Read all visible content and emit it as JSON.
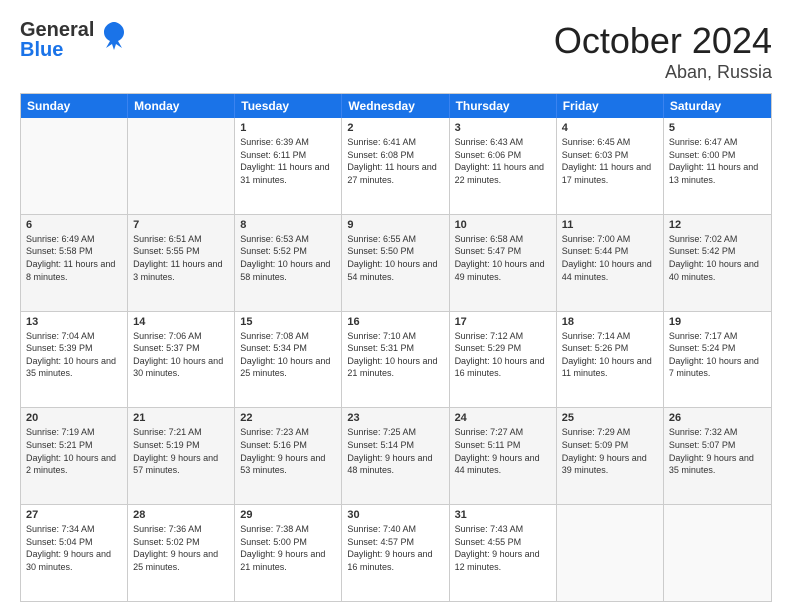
{
  "logo": {
    "line1": "General",
    "line2": "Blue"
  },
  "title": "October 2024",
  "subtitle": "Aban, Russia",
  "days": [
    "Sunday",
    "Monday",
    "Tuesday",
    "Wednesday",
    "Thursday",
    "Friday",
    "Saturday"
  ],
  "weeks": [
    [
      {
        "day": "",
        "text": "",
        "empty": true
      },
      {
        "day": "",
        "text": "",
        "empty": true
      },
      {
        "day": "1",
        "text": "Sunrise: 6:39 AM\nSunset: 6:11 PM\nDaylight: 11 hours and 31 minutes."
      },
      {
        "day": "2",
        "text": "Sunrise: 6:41 AM\nSunset: 6:08 PM\nDaylight: 11 hours and 27 minutes."
      },
      {
        "day": "3",
        "text": "Sunrise: 6:43 AM\nSunset: 6:06 PM\nDaylight: 11 hours and 22 minutes."
      },
      {
        "day": "4",
        "text": "Sunrise: 6:45 AM\nSunset: 6:03 PM\nDaylight: 11 hours and 17 minutes."
      },
      {
        "day": "5",
        "text": "Sunrise: 6:47 AM\nSunset: 6:00 PM\nDaylight: 11 hours and 13 minutes."
      }
    ],
    [
      {
        "day": "6",
        "text": "Sunrise: 6:49 AM\nSunset: 5:58 PM\nDaylight: 11 hours and 8 minutes."
      },
      {
        "day": "7",
        "text": "Sunrise: 6:51 AM\nSunset: 5:55 PM\nDaylight: 11 hours and 3 minutes."
      },
      {
        "day": "8",
        "text": "Sunrise: 6:53 AM\nSunset: 5:52 PM\nDaylight: 10 hours and 58 minutes."
      },
      {
        "day": "9",
        "text": "Sunrise: 6:55 AM\nSunset: 5:50 PM\nDaylight: 10 hours and 54 minutes."
      },
      {
        "day": "10",
        "text": "Sunrise: 6:58 AM\nSunset: 5:47 PM\nDaylight: 10 hours and 49 minutes."
      },
      {
        "day": "11",
        "text": "Sunrise: 7:00 AM\nSunset: 5:44 PM\nDaylight: 10 hours and 44 minutes."
      },
      {
        "day": "12",
        "text": "Sunrise: 7:02 AM\nSunset: 5:42 PM\nDaylight: 10 hours and 40 minutes."
      }
    ],
    [
      {
        "day": "13",
        "text": "Sunrise: 7:04 AM\nSunset: 5:39 PM\nDaylight: 10 hours and 35 minutes."
      },
      {
        "day": "14",
        "text": "Sunrise: 7:06 AM\nSunset: 5:37 PM\nDaylight: 10 hours and 30 minutes."
      },
      {
        "day": "15",
        "text": "Sunrise: 7:08 AM\nSunset: 5:34 PM\nDaylight: 10 hours and 25 minutes."
      },
      {
        "day": "16",
        "text": "Sunrise: 7:10 AM\nSunset: 5:31 PM\nDaylight: 10 hours and 21 minutes."
      },
      {
        "day": "17",
        "text": "Sunrise: 7:12 AM\nSunset: 5:29 PM\nDaylight: 10 hours and 16 minutes."
      },
      {
        "day": "18",
        "text": "Sunrise: 7:14 AM\nSunset: 5:26 PM\nDaylight: 10 hours and 11 minutes."
      },
      {
        "day": "19",
        "text": "Sunrise: 7:17 AM\nSunset: 5:24 PM\nDaylight: 10 hours and 7 minutes."
      }
    ],
    [
      {
        "day": "20",
        "text": "Sunrise: 7:19 AM\nSunset: 5:21 PM\nDaylight: 10 hours and 2 minutes."
      },
      {
        "day": "21",
        "text": "Sunrise: 7:21 AM\nSunset: 5:19 PM\nDaylight: 9 hours and 57 minutes."
      },
      {
        "day": "22",
        "text": "Sunrise: 7:23 AM\nSunset: 5:16 PM\nDaylight: 9 hours and 53 minutes."
      },
      {
        "day": "23",
        "text": "Sunrise: 7:25 AM\nSunset: 5:14 PM\nDaylight: 9 hours and 48 minutes."
      },
      {
        "day": "24",
        "text": "Sunrise: 7:27 AM\nSunset: 5:11 PM\nDaylight: 9 hours and 44 minutes."
      },
      {
        "day": "25",
        "text": "Sunrise: 7:29 AM\nSunset: 5:09 PM\nDaylight: 9 hours and 39 minutes."
      },
      {
        "day": "26",
        "text": "Sunrise: 7:32 AM\nSunset: 5:07 PM\nDaylight: 9 hours and 35 minutes."
      }
    ],
    [
      {
        "day": "27",
        "text": "Sunrise: 7:34 AM\nSunset: 5:04 PM\nDaylight: 9 hours and 30 minutes."
      },
      {
        "day": "28",
        "text": "Sunrise: 7:36 AM\nSunset: 5:02 PM\nDaylight: 9 hours and 25 minutes."
      },
      {
        "day": "29",
        "text": "Sunrise: 7:38 AM\nSunset: 5:00 PM\nDaylight: 9 hours and 21 minutes."
      },
      {
        "day": "30",
        "text": "Sunrise: 7:40 AM\nSunset: 4:57 PM\nDaylight: 9 hours and 16 minutes."
      },
      {
        "day": "31",
        "text": "Sunrise: 7:43 AM\nSunset: 4:55 PM\nDaylight: 9 hours and 12 minutes."
      },
      {
        "day": "",
        "text": "",
        "empty": true
      },
      {
        "day": "",
        "text": "",
        "empty": true
      }
    ]
  ]
}
